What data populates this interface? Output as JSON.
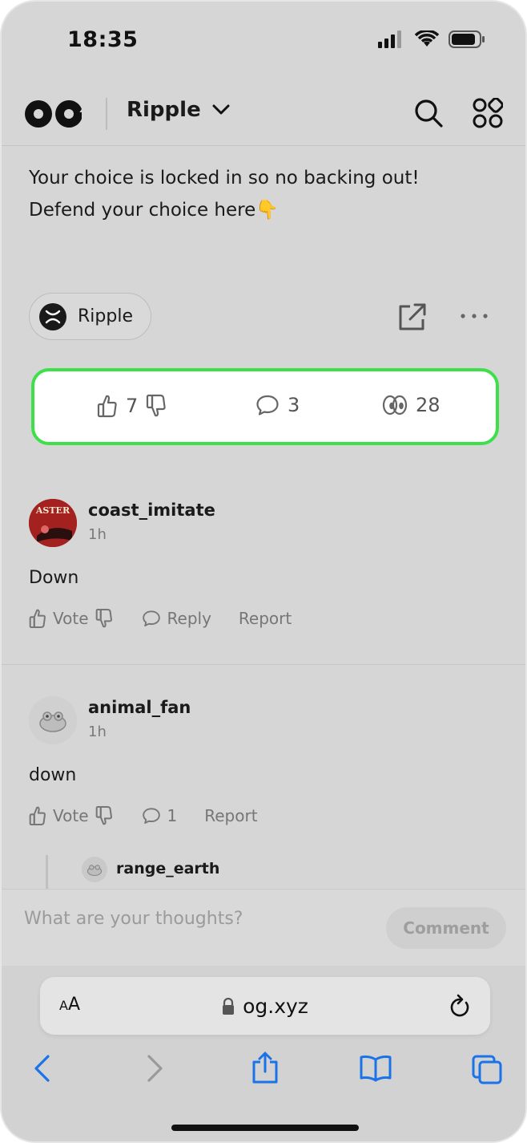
{
  "status_bar": {
    "time": "18:35"
  },
  "header": {
    "community": "Ripple"
  },
  "post": {
    "text_line1": "Your choice is locked in so no backing out!",
    "text_line2": "Defend your choice here",
    "emoji": "👇",
    "topic": "Ripple",
    "stats": {
      "votes": "7",
      "comments": "3",
      "views": "28"
    }
  },
  "comments": [
    {
      "user": "coast_imitate",
      "time": "1h",
      "body": "Down",
      "vote_label": "Vote",
      "reply_label": "Reply",
      "report_label": "Report"
    },
    {
      "user": "animal_fan",
      "time": "1h",
      "body": "down",
      "vote_label": "Vote",
      "reply_count": "1",
      "report_label": "Report"
    }
  ],
  "reply_preview": {
    "user": "range_earth"
  },
  "composer": {
    "placeholder": "What are your thoughts?",
    "button": "Comment"
  },
  "browser": {
    "aa": "AA",
    "url": "og.xyz"
  },
  "colors": {
    "highlight": "#3ee04a",
    "browser_blue": "#1a73e8"
  }
}
